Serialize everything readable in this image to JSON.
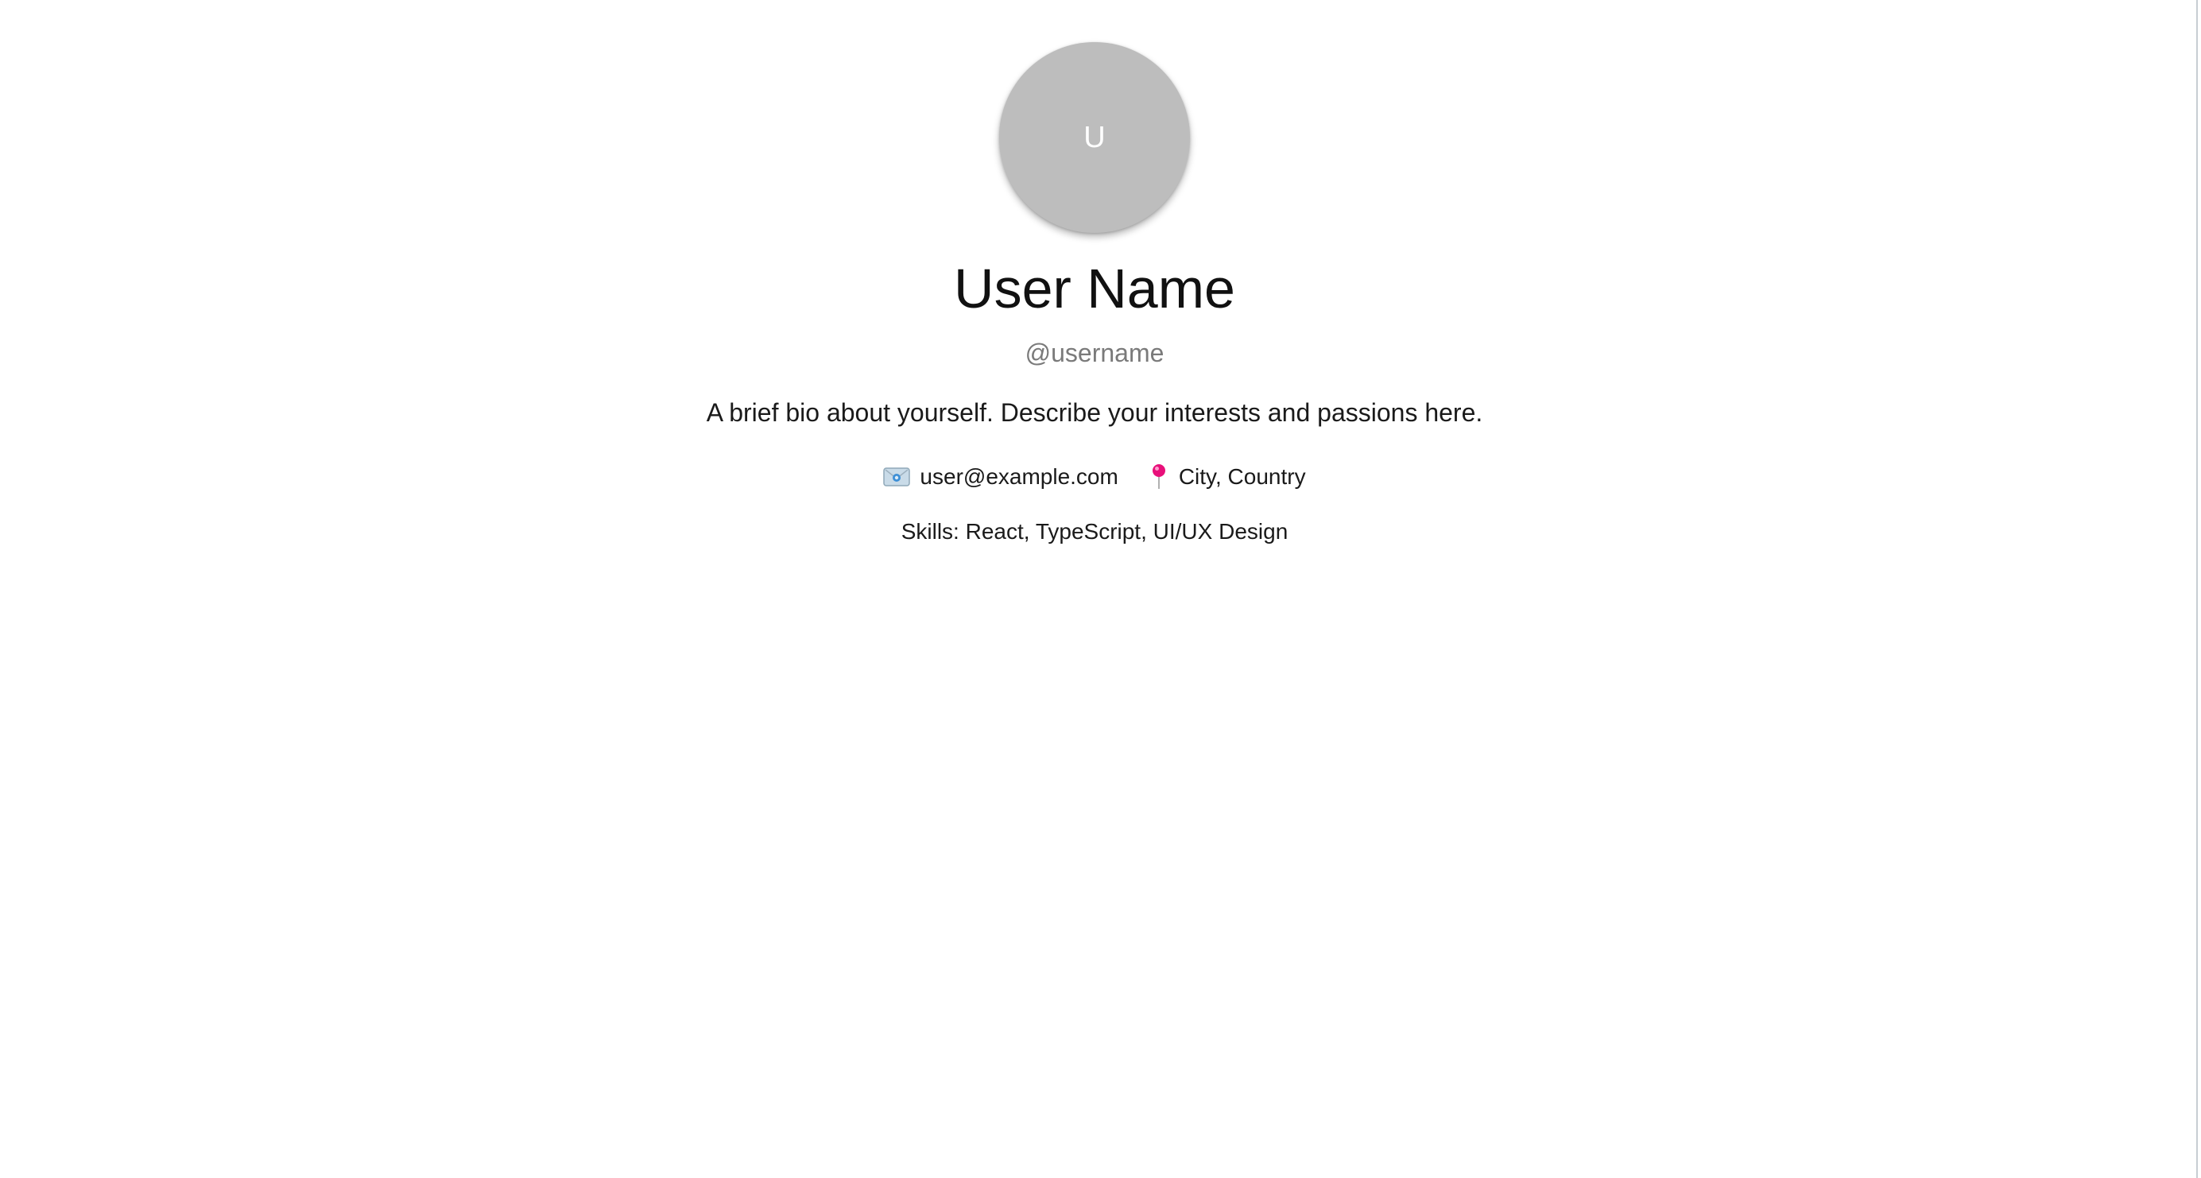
{
  "profile": {
    "avatar_initial": "U",
    "name": "User Name",
    "handle": "@username",
    "bio": "A brief bio about yourself. Describe your interests and passions here.",
    "contact": {
      "email_icon": "email-icon",
      "email": "user@example.com",
      "location_icon": "map-pin-icon",
      "location": "City, Country"
    },
    "skills": "Skills: React, TypeScript, UI/UX Design"
  },
  "colors": {
    "avatar_bg": "#bdbdbd",
    "handle_text": "#7a7a7a",
    "pin_red": "#e8107a"
  }
}
